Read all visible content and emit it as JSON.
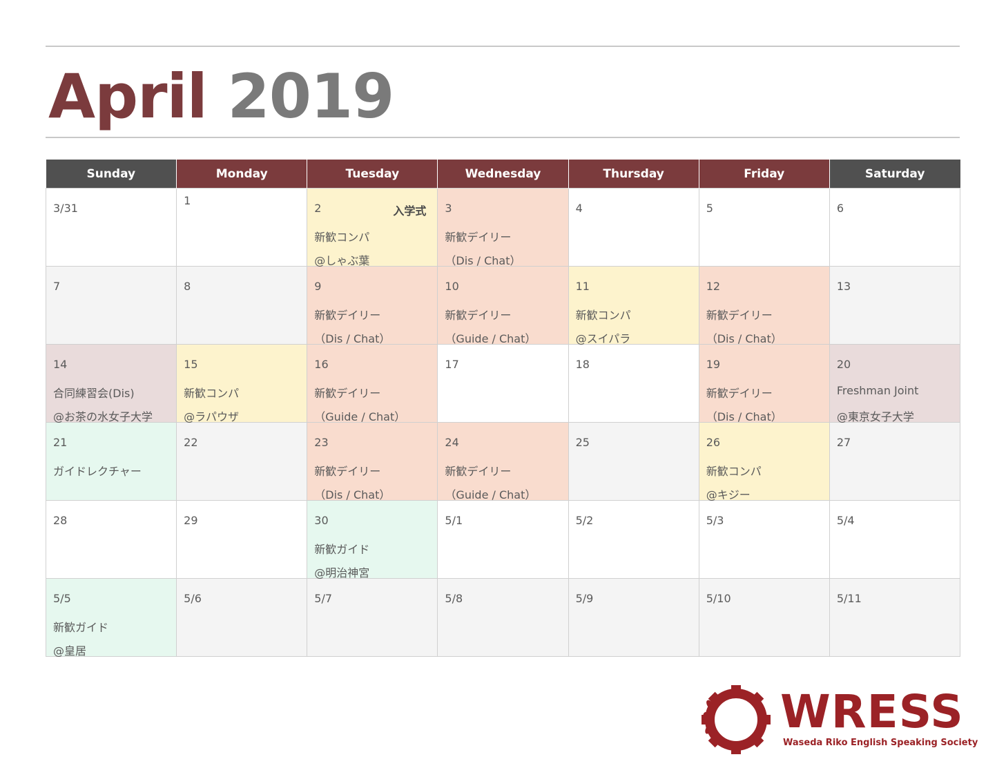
{
  "title": {
    "month": "April",
    "year": "2019"
  },
  "weekdays": [
    "Sunday",
    "Monday",
    "Tuesday",
    "Wednesday",
    "Thursday",
    "Friday",
    "Saturday"
  ],
  "weeks": [
    [
      {
        "date": "3/31",
        "line1": "",
        "line2": "",
        "tag": ""
      },
      {
        "date": "1",
        "line1": "",
        "line2": "",
        "tag": ""
      },
      {
        "date": "2",
        "line1": "新歓コンパ",
        "line2": "@しゃぶ葉",
        "tag": "入学式"
      },
      {
        "date": "3",
        "line1": "新歓デイリー",
        "line2": "（Dis / Chat）",
        "tag": ""
      },
      {
        "date": "4",
        "line1": "",
        "line2": "",
        "tag": ""
      },
      {
        "date": "5",
        "line1": "",
        "line2": "",
        "tag": ""
      },
      {
        "date": "6",
        "line1": "",
        "line2": "",
        "tag": ""
      }
    ],
    [
      {
        "date": "7",
        "line1": "",
        "line2": "",
        "tag": ""
      },
      {
        "date": "8",
        "line1": "",
        "line2": "",
        "tag": ""
      },
      {
        "date": "9",
        "line1": "新歓デイリー",
        "line2": "（Dis / Chat）",
        "tag": ""
      },
      {
        "date": "10",
        "line1": "新歓デイリー",
        "line2": "（Guide / Chat）",
        "tag": ""
      },
      {
        "date": "11",
        "line1": "新歓コンパ",
        "line2": "@スイパラ",
        "tag": ""
      },
      {
        "date": "12",
        "line1": "新歓デイリー",
        "line2": "（Dis / Chat）",
        "tag": ""
      },
      {
        "date": "13",
        "line1": "",
        "line2": "",
        "tag": ""
      }
    ],
    [
      {
        "date": "14",
        "line1": "合同練習会(Dis)",
        "line2": "@お茶の水女子大学",
        "tag": ""
      },
      {
        "date": "15",
        "line1": "新歓コンパ",
        "line2": "@ラパウザ",
        "tag": ""
      },
      {
        "date": "16",
        "line1": "新歓デイリー",
        "line2": "（Guide / Chat）",
        "tag": ""
      },
      {
        "date": "17",
        "line1": "",
        "line2": "",
        "tag": ""
      },
      {
        "date": "18",
        "line1": "",
        "line2": "",
        "tag": ""
      },
      {
        "date": "19",
        "line1": "新歓デイリー",
        "line2": "（Dis / Chat）",
        "tag": ""
      },
      {
        "date": "20",
        "line1": "Freshman Joint",
        "line2": "@東京女子大学",
        "tag": ""
      }
    ],
    [
      {
        "date": "21",
        "line1": "ガイドレクチャー",
        "line2": "",
        "tag": ""
      },
      {
        "date": "22",
        "line1": "",
        "line2": "",
        "tag": ""
      },
      {
        "date": "23",
        "line1": "新歓デイリー",
        "line2": "（Dis / Chat）",
        "tag": ""
      },
      {
        "date": "24",
        "line1": "新歓デイリー",
        "line2": "（Guide / Chat）",
        "tag": ""
      },
      {
        "date": "25",
        "line1": "",
        "line2": "",
        "tag": ""
      },
      {
        "date": "26",
        "line1": "新歓コンパ",
        "line2": "@キジー",
        "tag": ""
      },
      {
        "date": "27",
        "line1": "",
        "line2": "",
        "tag": ""
      }
    ],
    [
      {
        "date": "28",
        "line1": "",
        "line2": "",
        "tag": ""
      },
      {
        "date": "29",
        "line1": "",
        "line2": "",
        "tag": ""
      },
      {
        "date": "30",
        "line1": "新歓ガイド",
        "line2": "@明治神宮",
        "tag": ""
      },
      {
        "date": "5/1",
        "line1": "",
        "line2": "",
        "tag": ""
      },
      {
        "date": "5/2",
        "line1": "",
        "line2": "",
        "tag": ""
      },
      {
        "date": "5/3",
        "line1": "",
        "line2": "",
        "tag": ""
      },
      {
        "date": "5/4",
        "line1": "",
        "line2": "",
        "tag": ""
      }
    ],
    [
      {
        "date": "5/5",
        "line1": "新歓ガイド",
        "line2": "@皇居",
        "tag": ""
      },
      {
        "date": "5/6",
        "line1": "",
        "line2": "",
        "tag": ""
      },
      {
        "date": "5/7",
        "line1": "",
        "line2": "",
        "tag": ""
      },
      {
        "date": "5/8",
        "line1": "",
        "line2": "",
        "tag": ""
      },
      {
        "date": "5/9",
        "line1": "",
        "line2": "",
        "tag": ""
      },
      {
        "date": "5/10",
        "line1": "",
        "line2": "",
        "tag": ""
      },
      {
        "date": "5/11",
        "line1": "",
        "line2": "",
        "tag": ""
      }
    ]
  ],
  "logo": {
    "name": "WRESS",
    "subtitle": "Waseda Riko English Speaking Society",
    "color": "#9b2226",
    "icon": "gear-icon"
  },
  "colors": {
    "header_dark": "#505050",
    "header_red": "#7b3b3d",
    "event_compa": "#fdf3cd",
    "event_daily": "#f9dcce",
    "event_joint": "#e9dbdb",
    "event_guide": "#e6f8ef"
  }
}
